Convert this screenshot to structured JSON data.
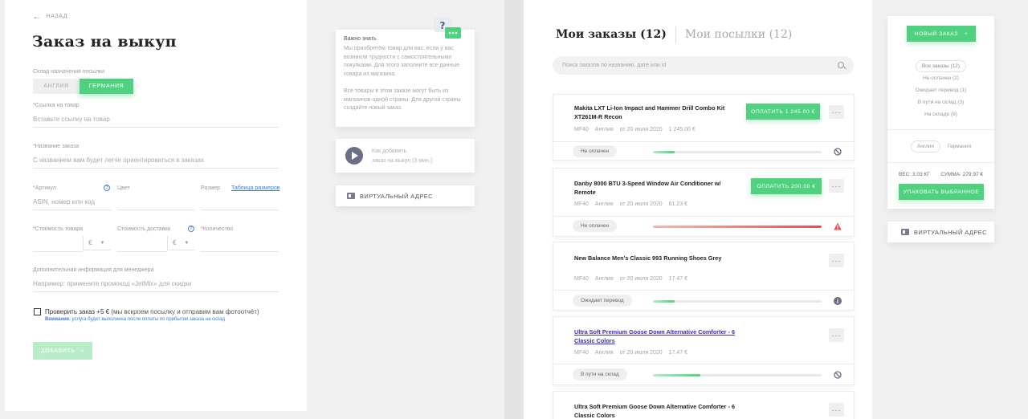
{
  "left": {
    "back_label": "НАЗАД",
    "title": "Заказ на выкуп",
    "warehouse_label": "Склад назначения посылки",
    "warehouse_options": [
      "АНГЛИЯ",
      "ГЕРМАНИЯ"
    ],
    "link_label": "*Ссылка на товар",
    "link_placeholder": "Вставьте ссылку на товар",
    "order_name_label": "*Название заказа",
    "order_name_placeholder": "С названием вам будет легче ориентироваться в заказах",
    "article_label": "*Артикул",
    "article_placeholder": "ASIN, номер или код",
    "color_label": "Цвет",
    "size_label": "Размер",
    "size_table_link": "Таблица размеров",
    "price_label": "*Стоимость товара",
    "delivery_label": "Стоимость доставки",
    "currency": "€",
    "qty_label": "*Количество",
    "extra_label": "Дополнительная информация для менеджера",
    "extra_placeholder": "Например: примените промокод «JetMix» для скидки",
    "check_label": "Проверить заказ +5 €",
    "check_desc": "(мы вскроем посылку и отправим вам фотоотчёт)",
    "note_prefix": "Внимание:",
    "note_text": "услуга будет выполнена после оплаты по прибытии заказа на склад",
    "add_button": "ДОБАВИТЬ",
    "info_title": "Важно знать",
    "info_text_1": "Мы приобретём товар для вас, если у вас возникли трудности с самостоятельными покупками. Для этого заполните все данные товара из магазина.",
    "info_text_2": "Все товары в этом заказе могут быть из магазинов одной страны. Для другой страны создайте новый заказ.",
    "video_text_1": "Как добавить",
    "video_text_2": "заказ на выкуп (3 мин.)",
    "virtual_address": "ВИРТУАЛЬНЫЙ АДРЕС"
  },
  "right": {
    "tab_orders": "Мои заказы (12)",
    "tab_parcels": "Мои посылки (12)",
    "search_placeholder": "Поиск заказов по названию, дате или id",
    "orders": [
      {
        "title": "Makita LXT Li-Ion Impact and Hammer Drill Combo Kit XT261M-R Recon",
        "code": "MF40",
        "country": "Англия",
        "date": "от 20 июля 2020",
        "price": "1 245.00 €",
        "pay": "ОПЛАТИТЬ 1 245.00 €",
        "status": "Не оплачен",
        "progress": 0.13
      },
      {
        "title": "Danby 8000 BTU 3-Speed Window Air Conditioner w/ Remote",
        "code": "MF40",
        "country": "Англия",
        "date": "от 20 июля 2020",
        "price": "61.23 €",
        "pay": "ОПЛАТИТЬ 200.00 €",
        "status": "Не оплачен",
        "progress": 1.0
      },
      {
        "title": "New Balance Men's Classic 993 Running Shoes Grey",
        "code": "MF40",
        "country": "Англия",
        "date": "от 20 июля 2020",
        "price": "17.47 €",
        "status": "Ожидает перевод",
        "progress": 0.13
      },
      {
        "title": "Ultra Soft Premium Goose Down Alternative Comforter - 6 Classic Colors",
        "code": "MF40",
        "country": "Англия",
        "date": "от 20 июля 2020",
        "price": "17.47 €",
        "status": "В пути на склад",
        "progress": 0.28
      },
      {
        "title": "Ultra Soft Premium Goose Down Alternative Comforter - 6 Classic Colors"
      }
    ],
    "new_order": "НОВЫЙ ЗАКАЗ",
    "filters": [
      "Все заказы (12)",
      "Не оплачен (2)",
      "Ожидает перевод (1)",
      "В пути на склад (3)",
      "На складе (6)"
    ],
    "countries": [
      "Англия",
      "Германия"
    ],
    "weight": "ВЕС: 3.03 КГ",
    "sum": "СУММА: 279.97 €",
    "pack_button": "УПАКОВАТЬ ВЫБРАННОЕ",
    "virtual_address": "ВИРТУАЛЬНЫЙ АДРЕС"
  },
  "colors": {
    "accent": "#4fd17f",
    "link": "#3b7be0",
    "danger": "#e84f4f"
  }
}
